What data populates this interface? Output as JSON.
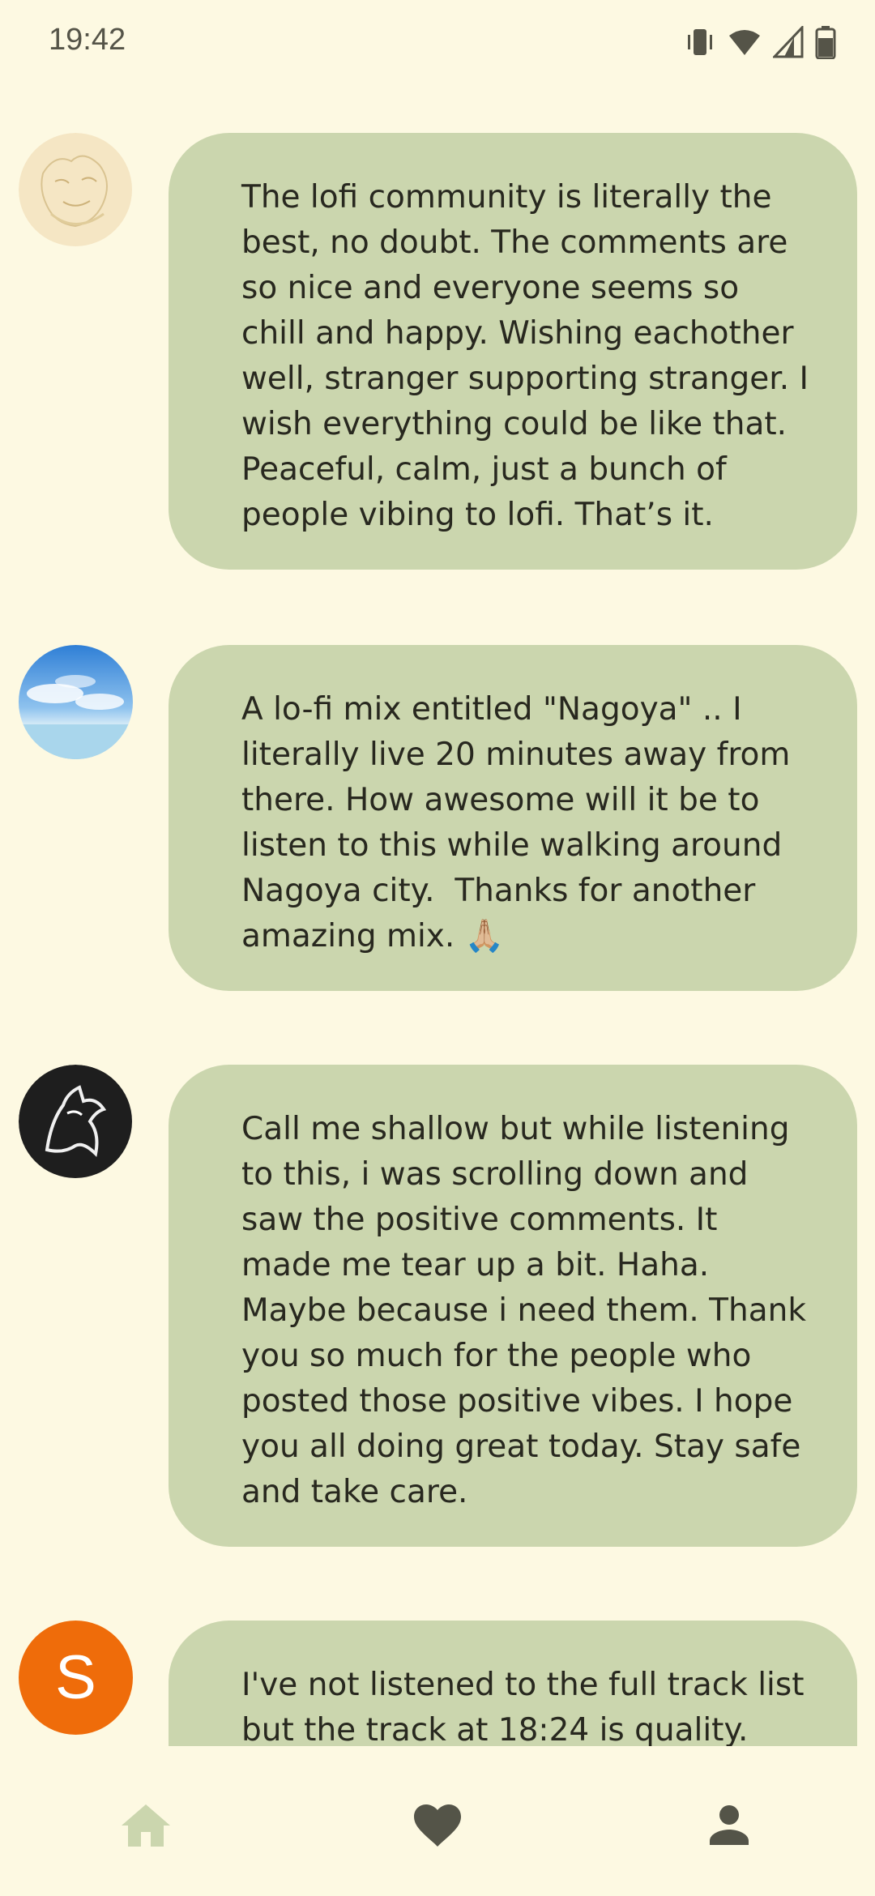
{
  "status_bar": {
    "time": "19:42",
    "icons": [
      "vibrate-icon",
      "wifi-icon",
      "signal-icon",
      "battery-icon"
    ]
  },
  "comments": [
    {
      "avatar": "sketch-illustration-avatar",
      "text": "The lofi community is literally the best, no doubt. The comments are so nice and everyone seems so chill and happy. Wishing eachother well, stranger supporting stranger. I wish everything could be like that. Peaceful, calm, just a bunch of people vibing to lofi. That’s it."
    },
    {
      "avatar": "sky-sea-avatar",
      "text": "A lo-fi mix entitled \"Nagoya\" .. I literally live 20 minutes away from there. How awesome will it be to listen to this while walking around Nagoya city.  Thanks for another amazing mix. 🙏🏼"
    },
    {
      "avatar": "wolf-avatar",
      "text": "Call me shallow but while listening to this, i was scrolling down and saw the positive comments. It made me tear up a bit. Haha. Maybe because i need them. Thank you so much for the people who posted those positive vibes. I hope you all doing great today. Stay safe and take care."
    },
    {
      "avatar": "letter-avatar",
      "avatar_letter": "S",
      "avatar_color": "#ef6c0a",
      "text": "I've not listened to the full track list but the track at 18:24 is quality."
    }
  ],
  "bottom_nav": {
    "items": [
      "home-icon",
      "heart-icon",
      "profile-icon"
    ],
    "active": "heart-icon"
  },
  "colors": {
    "background": "#fdf9e2",
    "bubble": "#cbd6ae",
    "nav_inactive": "#cbd6ae",
    "nav_active": "#545448"
  }
}
